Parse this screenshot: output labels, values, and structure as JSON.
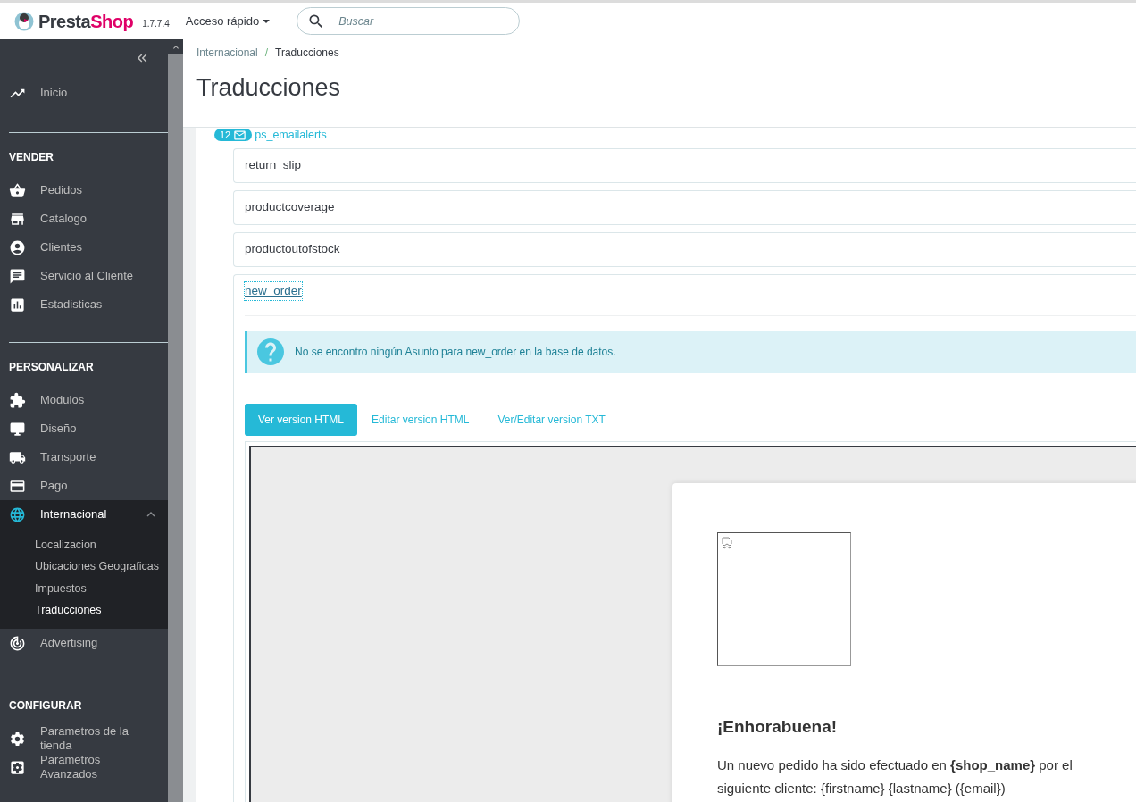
{
  "header": {
    "logo": {
      "part_1": "Presta",
      "part_2": "Shop"
    },
    "version": "1.7.7.4",
    "quick_access": "Acceso rápido",
    "search": {
      "placeholder": "Buscar"
    }
  },
  "sidebar": {
    "top": [
      {
        "label": "Inicio",
        "selected": false
      }
    ],
    "sections": [
      {
        "title": "VENDER",
        "items": [
          {
            "label": "Pedidos",
            "selected": false
          },
          {
            "label": "Catalogo",
            "selected": false
          },
          {
            "label": "Clientes",
            "selected": false
          },
          {
            "label": "Servicio al Cliente",
            "selected": false
          },
          {
            "label": "Estadisticas",
            "selected": false
          }
        ]
      },
      {
        "title": "PERSONALIZAR",
        "items": [
          {
            "label": "Modulos",
            "selected": false
          },
          {
            "label": "Diseño",
            "selected": false
          },
          {
            "label": "Transporte",
            "selected": false
          },
          {
            "label": "Pago",
            "selected": false
          },
          {
            "label": "Internacional",
            "selected": true,
            "expanded": true,
            "children": [
              {
                "label": "Localizacion",
                "selected": false
              },
              {
                "label": "Ubicaciones Geograficas",
                "selected": false
              },
              {
                "label": "Impuestos",
                "selected": false
              },
              {
                "label": "Traducciones",
                "selected": true
              }
            ]
          },
          {
            "label": "Advertising",
            "selected": false
          }
        ]
      },
      {
        "title": "CONFIGURAR",
        "items": [
          {
            "label": "Parametros de la tienda",
            "selected": false
          },
          {
            "label": "Parametros Avanzados",
            "selected": false
          }
        ]
      }
    ]
  },
  "breadcrumb": {
    "items": [
      "Internacional",
      "Traducciones"
    ],
    "separator": "/"
  },
  "page_title": "Traducciones",
  "module": {
    "count": "12",
    "name": "ps_emailalerts",
    "templates": [
      {
        "name": "return_slip",
        "expanded": false
      },
      {
        "name": "productcoverage",
        "expanded": false
      },
      {
        "name": "productoutofstock",
        "expanded": false
      },
      {
        "name": "new_order",
        "expanded": true
      }
    ],
    "info_message": "No se encontro ningún Asunto para new_order en la base de datos.",
    "tabs": [
      {
        "label": "Ver version HTML",
        "selected": true
      },
      {
        "label": "Editar version HTML",
        "selected": false
      },
      {
        "label": "Ver/Editar version TXT",
        "selected": false
      }
    ],
    "preview": {
      "heading": "¡Enhorabuena!",
      "paragraph": "Un nuevo pedido ha sido efectuado en **{shop_name}** por el siguiente cliente: {firstname} {lastname} ({email})"
    }
  }
}
